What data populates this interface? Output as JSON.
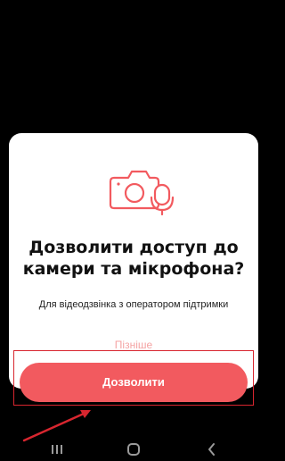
{
  "dialog": {
    "icon": "camera-microphone-icon",
    "title_line1": "Дозволити доступ до",
    "title_line2": "камери та мікрофона?",
    "subtitle": "Для відеодзвінка з оператором підтримки",
    "later_label": "Пізніше",
    "allow_label": "Дозволити"
  },
  "annotations": {
    "highlight_color": "#d8262f",
    "arrow_icon": "pointer-arrow-icon"
  },
  "navbar": {
    "recents_icon": "recents-icon",
    "home_icon": "home-icon",
    "back_icon": "back-icon"
  },
  "colors": {
    "accent": "#f25a5f",
    "background": "#000000",
    "dialog": "#ffffff"
  }
}
